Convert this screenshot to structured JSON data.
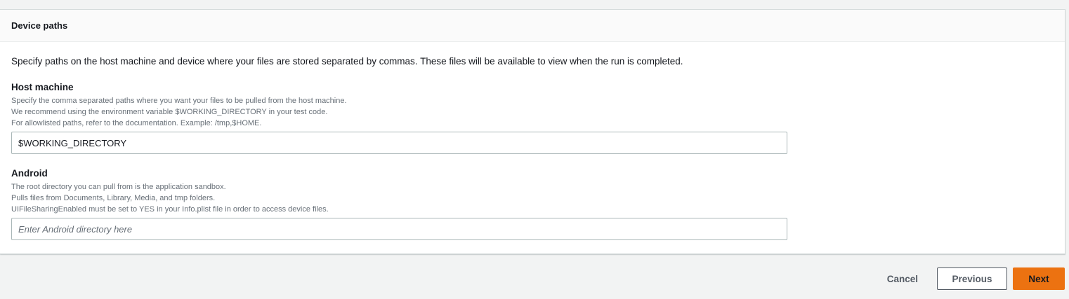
{
  "panel": {
    "title": "Device paths",
    "description": "Specify paths on the host machine and device where your files are stored separated by commas. These files will be available to view when the run is completed."
  },
  "host_machine": {
    "label": "Host machine",
    "description_lines": [
      "Specify the comma separated paths where you want your files to be pulled from the host machine.",
      "We recommend using the environment variable $WORKING_DIRECTORY in your test code.",
      "For allowlisted paths, refer to the documentation. Example: /tmp,$HOME."
    ],
    "value": "$WORKING_DIRECTORY",
    "placeholder": ""
  },
  "android": {
    "label": "Android",
    "description_lines": [
      "The root directory you can pull from is the application sandbox.",
      "Pulls files from Documents, Library, Media, and tmp folders.",
      "UIFileSharingEnabled must be set to YES in your Info.plist file in order to access device files."
    ],
    "value": "",
    "placeholder": "Enter Android directory here"
  },
  "footer": {
    "cancel_label": "Cancel",
    "previous_label": "Previous",
    "next_label": "Next"
  },
  "colors": {
    "primary_button": "#ec7211",
    "page_background": "#f2f3f3",
    "panel_header_background": "#fafafa"
  }
}
